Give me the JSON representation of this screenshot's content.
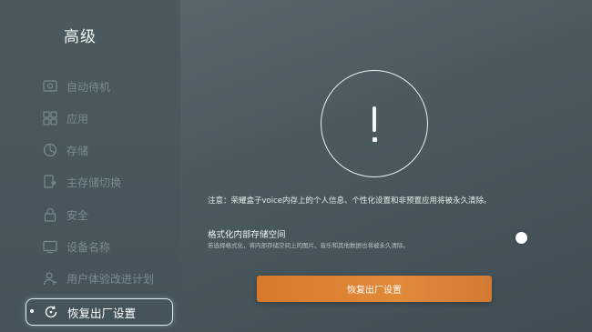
{
  "sidebar": {
    "title": "高级",
    "items": [
      {
        "label": "自动待机",
        "icon": "standby-icon"
      },
      {
        "label": "应用",
        "icon": "apps-icon"
      },
      {
        "label": "存储",
        "icon": "storage-icon"
      },
      {
        "label": "主存储切换",
        "icon": "storage-switch-icon"
      },
      {
        "label": "安全",
        "icon": "lock-icon"
      },
      {
        "label": "设备名称",
        "icon": "device-icon"
      },
      {
        "label": "用户体验改进计划",
        "icon": "user-icon"
      },
      {
        "label": "恢复出厂设置",
        "icon": "restore-icon"
      }
    ],
    "active_index": 7
  },
  "main": {
    "notice": "注意：荣耀盒子voice内存上的个人信息、个性化设置和非预置应用将被永久清除。",
    "format_title": "格式化内部存储空间",
    "format_desc": "若选择格式化，将内部存储空间上的图片、音乐和其他数据也将被永久清除。",
    "toggle_on": false,
    "reset_button_label": "恢复出厂设置"
  },
  "colors": {
    "accent": "#e08a3a",
    "background": "#4b5a5f"
  }
}
